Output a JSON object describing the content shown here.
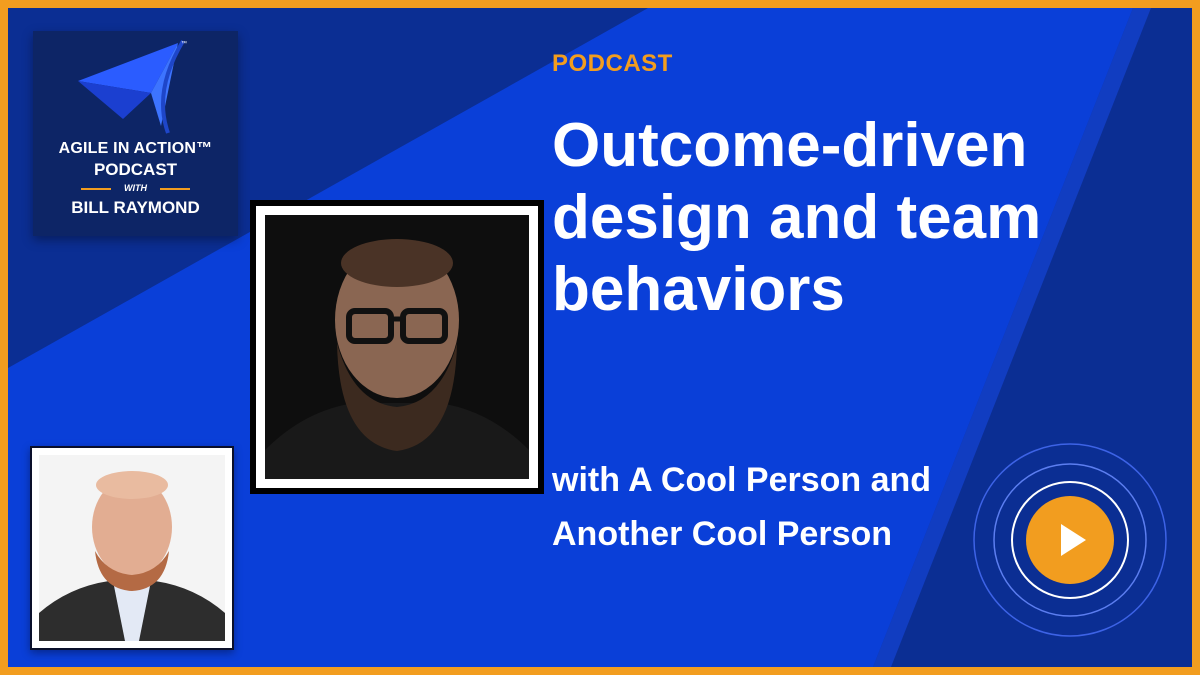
{
  "logo": {
    "line1": "AGILE IN ACTION™",
    "line2": "PODCAST",
    "with": "WITH",
    "host_name": "BILL RAYMOND",
    "tm": "™"
  },
  "label": "PODCAST",
  "title": "Outcome-driven design and team behaviors",
  "subtitle": "with A Cool Person and Another Cool Person",
  "colors": {
    "accent": "#f29d1f",
    "background": "#0a3fd8",
    "background_dark": "#0b2e93",
    "text": "#ffffff"
  },
  "icons": {
    "play": "play-icon"
  }
}
